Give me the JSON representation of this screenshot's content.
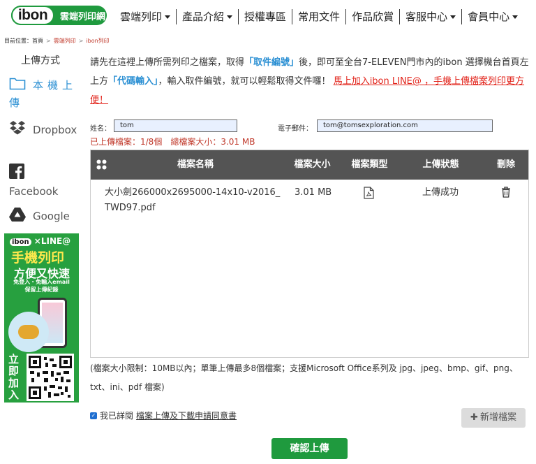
{
  "header": {
    "logo_text": "ibon",
    "logo_sub": "雲端列印網",
    "nav": [
      {
        "label": "雲端列印",
        "dropdown": true
      },
      {
        "label": "產品介紹",
        "dropdown": true
      },
      {
        "label": "授權專區",
        "dropdown": false
      },
      {
        "label": "常用文件",
        "dropdown": false
      },
      {
        "label": "作品欣賞",
        "dropdown": false
      },
      {
        "label": "客服中心",
        "dropdown": true
      },
      {
        "label": "會員中心",
        "dropdown": true
      }
    ]
  },
  "breadcrumb": {
    "prefix": "目前位置：首頁",
    "sep": ">",
    "level1": "雲端列印",
    "level2": "ibon列印"
  },
  "sidebar": {
    "title": "上傳方式",
    "items": [
      {
        "label": "本機上傳",
        "icon": "folder-icon",
        "active": true
      },
      {
        "label": "Dropbox",
        "icon": "dropbox-icon",
        "active": false
      },
      {
        "label": "Facebook",
        "icon": "facebook-icon",
        "active": false
      },
      {
        "label": "Google",
        "icon": "google-drive-icon",
        "active": false
      }
    ]
  },
  "banner": {
    "top_brand": "ibon",
    "top_sep": "×",
    "top_line": "LINE@",
    "headline1": "手機列印",
    "headline2": "方便又快速",
    "sub1": "免登入・免輸入email",
    "sub2": "保留上傳紀錄",
    "qr_label": "立即加入"
  },
  "intro": {
    "p1": "請先在這裡上傳所需列印之檔案，取得",
    "hl1": "「取件編號」",
    "p2": "後，即可至全台7-ELEVEN門市內的ibon 選擇機台首頁左上方",
    "hl2": "「代碼輸入」",
    "p3": "，輸入取件編號，就可以輕鬆取得文件囉！",
    "link": "馬上加入ibon LINE@ ，手機上傳檔案列印更方便！"
  },
  "form": {
    "name_label": "姓名：",
    "name_value": "tom",
    "email_label": "電子郵件：",
    "email_value": "tom@tomsexploration.com"
  },
  "status": {
    "uploaded": "已上傳檔案：1/8個",
    "total_size": "總檔案大小：3.01 MB"
  },
  "table": {
    "headers": {
      "name": "檔案名稱",
      "size": "檔案大小",
      "type": "檔案類型",
      "status": "上傳狀態",
      "delete": "刪除"
    },
    "rows": [
      {
        "name_line1": "大小劍266000x2695000-14x10-v2016_",
        "name_line2": "TWD97.pdf",
        "size": "3.01 MB",
        "type_icon": "pdf-file-icon",
        "status": "上傳成功",
        "delete_icon": "trash-icon"
      }
    ]
  },
  "footnote": "(檔案大小限制：10MB以內；單筆上傳最多8個檔案；支援Microsoft Office系列及 jpg、jpeg、bmp、gif、png、txt、ini、pdf 檔案)",
  "agreement": {
    "checked": true,
    "prefix": "我已詳閱",
    "link": "檔案上傳及下載申請同意書"
  },
  "buttons": {
    "add_file": "新增檔案",
    "confirm": "確認上傳"
  },
  "colors": {
    "brand_green": "#1f9a3e",
    "accent_blue": "#2a8fd3",
    "alert_red": "#e2231a",
    "table_header": "#545454"
  }
}
